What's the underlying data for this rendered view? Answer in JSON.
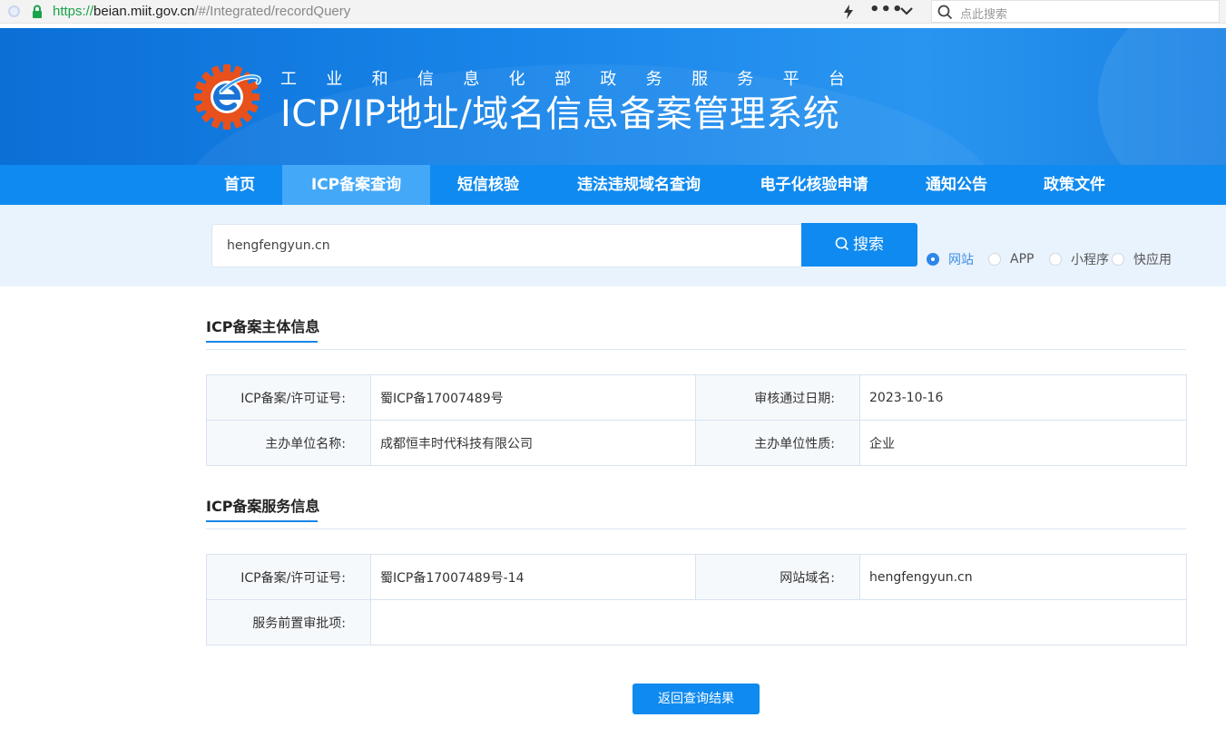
{
  "browser": {
    "url_scheme": "https://",
    "url_host": "beian.miit.gov.cn",
    "url_path": "/#/Integrated/recordQuery",
    "more_glyph": "•••",
    "search_placeholder": "点此搜索"
  },
  "banner": {
    "subtitle_chars": [
      "工",
      "业",
      "和",
      "信",
      "息",
      "化",
      "部",
      "政",
      "务",
      "服",
      "务",
      "平",
      "台"
    ],
    "title": "ICP/IP地址/域名信息备案管理系统"
  },
  "nav": {
    "items": [
      {
        "label": "首页",
        "active": false
      },
      {
        "label": "ICP备案查询",
        "active": true
      },
      {
        "label": "短信核验",
        "active": false
      },
      {
        "label": "违法违规域名查询",
        "active": false
      },
      {
        "label": "电子化核验申请",
        "active": false
      },
      {
        "label": "通知公告",
        "active": false
      },
      {
        "label": "政策文件",
        "active": false
      }
    ]
  },
  "search": {
    "value": "hengfengyun.cn",
    "button_label": "搜索",
    "options": [
      {
        "label": "网站",
        "checked": true
      },
      {
        "label": "APP",
        "checked": false
      },
      {
        "label": "小程序",
        "checked": false
      },
      {
        "label": "快应用",
        "checked": false
      }
    ]
  },
  "subject_info": {
    "title": "ICP备案主体信息",
    "license_label": "ICP备案/许可证号:",
    "license_value": "蜀ICP备17007489号",
    "approve_date_label": "审核通过日期:",
    "approve_date_value": "2023-10-16",
    "org_name_label": "主办单位名称:",
    "org_name_value": "成都恒丰时代科技有限公司",
    "org_type_label": "主办单位性质:",
    "org_type_value": "企业"
  },
  "service_info": {
    "title": "ICP备案服务信息",
    "license_label": "ICP备案/许可证号:",
    "license_value": "蜀ICP备17007489号-14",
    "domain_label": "网站域名:",
    "domain_value": "hengfengyun.cn",
    "pre_approval_label": "服务前置审批项:",
    "pre_approval_value": ""
  },
  "back_button_label": "返回查询结果",
  "colors": {
    "primary": "#0f8af0",
    "nav_active": "#43a8f8",
    "search_band": "#e9f3fd",
    "logo_orange": "#e8501c"
  }
}
